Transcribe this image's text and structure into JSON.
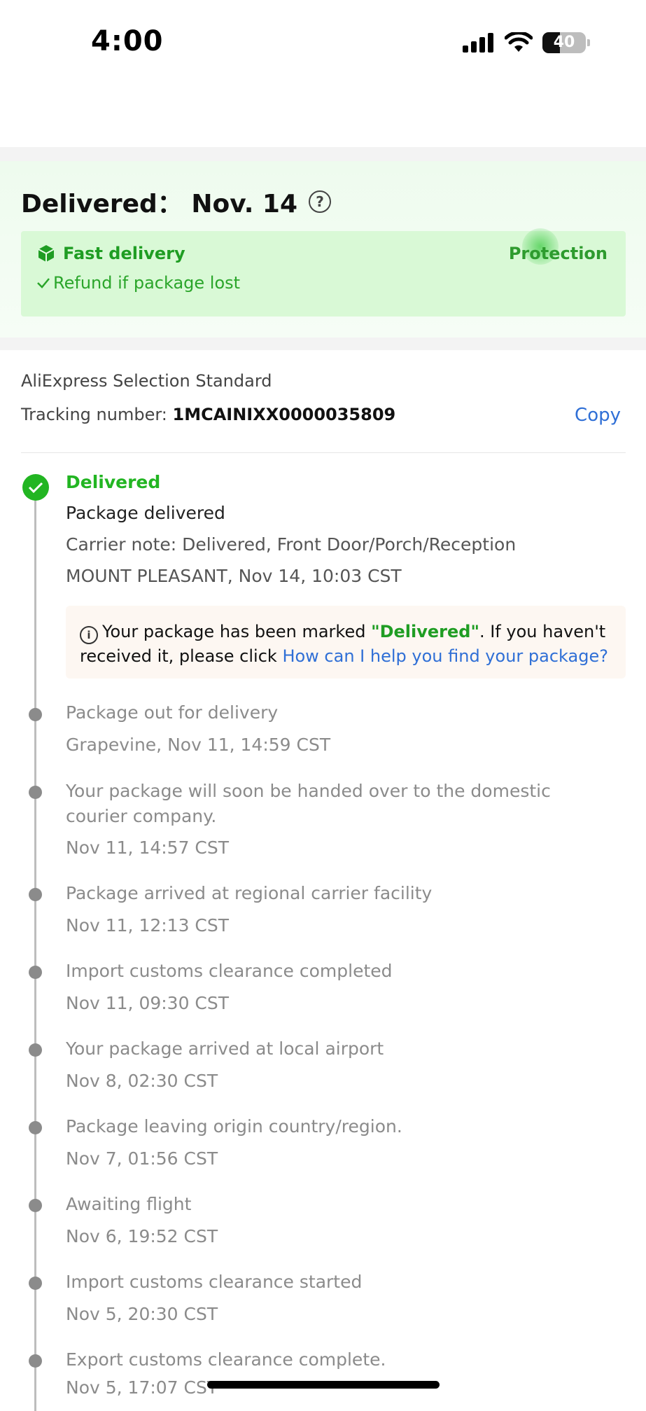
{
  "status_bar": {
    "time": "4:00",
    "battery": "40",
    "battery_level": 0.4
  },
  "delivery": {
    "title": "Delivered： Nov. 14",
    "help_icon": "question-circle-icon",
    "fast_delivery": "Fast delivery",
    "refund": "Refund if package lost",
    "protection": "Protection",
    "accent_color": "#22b522"
  },
  "tracking": {
    "method": "AliExpress Selection Standard",
    "number_label": "Tracking number:",
    "number": "1MCAINIXX0000035809",
    "copy": "Copy"
  },
  "latest": {
    "status": "Delivered",
    "title": "Package delivered",
    "note": "Carrier note: Delivered, Front Door/Porch/Reception",
    "location_time": "MOUNT PLEASANT, Nov 14, 10:03 CST"
  },
  "notice": {
    "prefix": "Your package has been marked ",
    "highlight": "\"Delivered\"",
    "middle": ". If you haven't received it, please click ",
    "link": "How can I help you find your package?"
  },
  "events": [
    {
      "title": "Package out for delivery",
      "time": "Grapevine, Nov 11, 14:59 CST"
    },
    {
      "title": "Your package will soon be handed over to the domestic courier company.",
      "time": "Nov 11, 14:57 CST"
    },
    {
      "title": "Package arrived at regional carrier facility",
      "time": "Nov 11, 12:13 CST"
    },
    {
      "title": "Import customs clearance completed",
      "time": "Nov 11, 09:30 CST"
    },
    {
      "title": "Your package arrived at local airport",
      "time": "Nov 8, 02:30 CST"
    },
    {
      "title": "Package leaving origin country/region.",
      "time": "Nov 7, 01:56 CST"
    },
    {
      "title": "Awaiting flight",
      "time": "Nov 6, 19:52 CST"
    },
    {
      "title": "Import customs clearance started",
      "time": "Nov 5, 20:30 CST"
    },
    {
      "title": "Export customs clearance complete.",
      "time": "Nov 5, 17:07 CST"
    }
  ]
}
